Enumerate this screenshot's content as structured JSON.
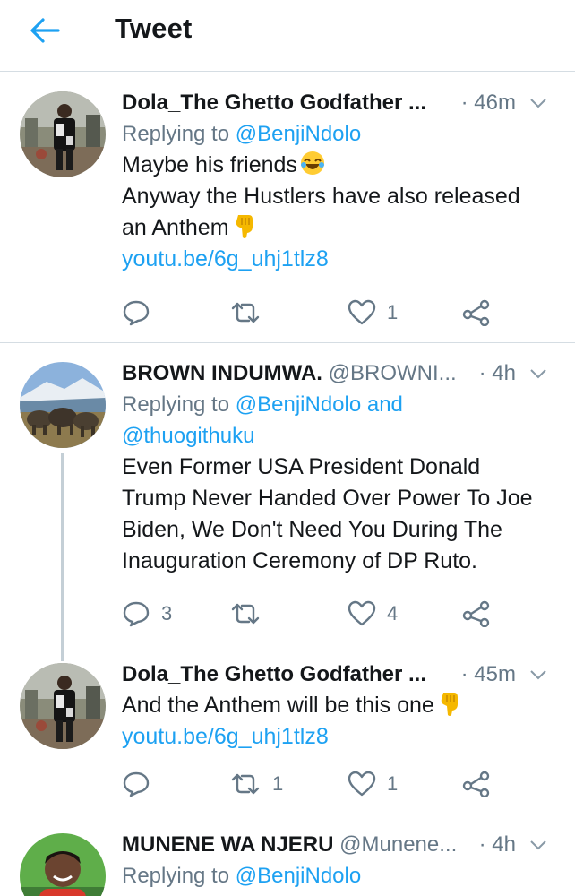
{
  "header": {
    "title": "Tweet",
    "back_icon": "arrow-left-icon"
  },
  "colors": {
    "accent": "#1da1f2",
    "muted": "#657786",
    "divider": "#d5dde3"
  },
  "tweets": [
    {
      "name": "Dola_The Ghetto Godfather ...",
      "handle": "",
      "time": "· 46m",
      "replying_prefix": "Replying to ",
      "replying_to": "@BenjiNdolo",
      "replying_and": "",
      "replying_to_2": "",
      "lines": [
        "Maybe his friends",
        "Anyway the Hustlers have also released",
        "an Anthem"
      ],
      "link": "youtu.be/6g_uhj1tlz8",
      "replies": "",
      "retweets": "",
      "likes": "1"
    },
    {
      "name": "BROWN INDUMWA.",
      "handle": "@BROWNI...",
      "time": "· 4h",
      "replying_prefix": "Replying to ",
      "replying_to": "@BenjiNdolo",
      "replying_and": " and",
      "replying_to_2": "@thuogithuku",
      "lines": [
        "Even Former USA President Donald",
        "Trump Never Handed Over Power To Joe",
        "Biden, We Don't Need You During The",
        "Inauguration Ceremony of DP Ruto."
      ],
      "link": "",
      "replies": "3",
      "retweets": "",
      "likes": "4"
    },
    {
      "name": "Dola_The Ghetto Godfather ...",
      "handle": "",
      "time": "· 45m",
      "lines": [
        "And the Anthem will be this one"
      ],
      "link": "youtu.be/6g_uhj1tlz8",
      "replies": "",
      "retweets": "1",
      "likes": "1"
    },
    {
      "name": "MUNENE WA NJERU",
      "handle": "@Munene...",
      "time": "· 4h",
      "replying_prefix": "Replying to ",
      "replying_to": "@BenjiNdolo"
    }
  ]
}
